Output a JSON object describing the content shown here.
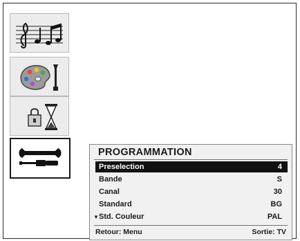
{
  "menu": {
    "title": "PROGRAMMATION",
    "items": [
      {
        "label": "Preselection",
        "value": "4"
      },
      {
        "label": "Bande",
        "value": "S"
      },
      {
        "label": "Canal",
        "value": "30"
      },
      {
        "label": "Standard",
        "value": "BG"
      },
      {
        "label": "Std. Couleur",
        "value": "PAL"
      }
    ],
    "more_below_indicator": "▼",
    "footer": {
      "left": "Retour: Menu",
      "right": "Sortie: TV"
    }
  },
  "sidebar": {
    "icons": [
      "music-icon",
      "palette-icon",
      "lock-timer-icon",
      "tools-icon"
    ],
    "active_index": 3
  },
  "colors": {
    "highlight": "#101010",
    "panel_bg": "#f1f1f1"
  }
}
